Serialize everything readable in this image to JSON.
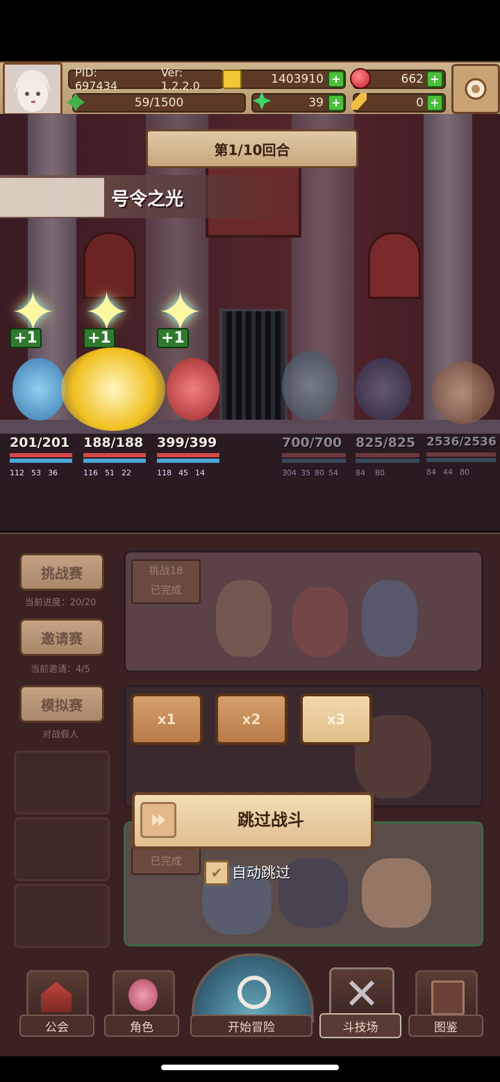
{
  "header": {
    "pid": "PID: 697434",
    "version": "Ver: 1.2.2.0",
    "gold": "1403910",
    "gems": "662",
    "stamina": "59/1500",
    "clover": "39",
    "tickets": "0"
  },
  "battle": {
    "round": "第1/10回合",
    "skill_name": "号令之光",
    "plus_labels": [
      "+1",
      "+1",
      "+1"
    ],
    "allies": [
      {
        "hp": "201/201",
        "stats": [
          "112",
          "53",
          "36"
        ]
      },
      {
        "hp": "188/188",
        "stats": [
          "116",
          "51",
          "22"
        ]
      },
      {
        "hp": "399/399",
        "stats": [
          "118",
          "45",
          "14"
        ]
      }
    ],
    "enemies": [
      {
        "hp": "700/700",
        "stats": [
          "304",
          "35",
          "80",
          "54"
        ]
      },
      {
        "hp": "825/825",
        "stats": [
          "84",
          "80"
        ]
      },
      {
        "hp": "2536/2536",
        "stats": [
          "84",
          "44",
          "80"
        ]
      }
    ]
  },
  "arena": {
    "tabs": [
      {
        "label": "挑战赛",
        "sub": "当前进度：20/20"
      },
      {
        "label": "邀请赛",
        "sub": "当前邀请：4/5"
      },
      {
        "label": "模拟赛",
        "sub": "对战假人"
      }
    ],
    "card1_tag_line1": "挑战18",
    "card1_tag_line2": "已完成",
    "card3_tag": "已完成",
    "speed_buttons": [
      "x1",
      "x2",
      "x3"
    ],
    "skip_label": "跳过战斗",
    "auto_skip_label": "自动跳过",
    "auto_skip_checked": true
  },
  "nav": {
    "items": [
      "公会",
      "角色",
      "开始冒险",
      "斗技场",
      "图鉴"
    ]
  },
  "colors": {
    "hp_red": "#d24a4a",
    "mp_blue": "#4aa6d8",
    "accent_tan": "#c9a276",
    "dark_brown": "#3a2222"
  }
}
